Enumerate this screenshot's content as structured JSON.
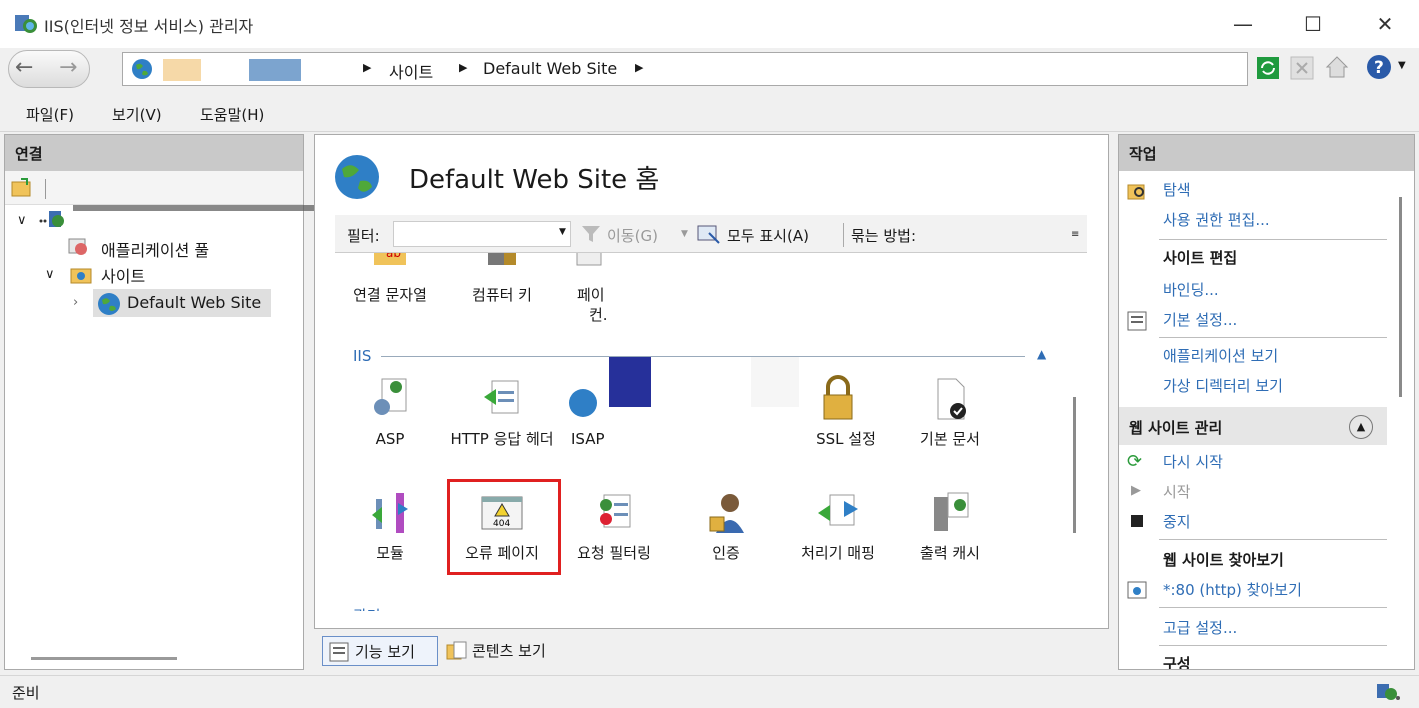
{
  "window": {
    "title": "IIS(인터넷 정보 서비스) 관리자",
    "minimize_icon": "minimize-icon",
    "maximize_icon": "maximize-icon",
    "close_icon": "close-icon"
  },
  "address": {
    "crumbs": [
      "사이트",
      "Default Web Site"
    ]
  },
  "menu": {
    "file": "파일(F)",
    "view": "보기(V)",
    "help": "도움말(H)"
  },
  "connections": {
    "title": "연결",
    "tree": {
      "app_pools": "애플리케이션 풀",
      "sites": "사이트",
      "site": "Default Web Site"
    }
  },
  "center": {
    "title": "Default Web Site 홈",
    "filter_label": "필터:",
    "go_label": "이동(G)",
    "show_all_label": "모두 표시(A)",
    "group_by_label": "묶는 방법:",
    "top_row": [
      "연결 문자열",
      "컴퓨터 키",
      "페이",
      "컨."
    ],
    "group_iis": "IIS",
    "iis_row1": [
      "ASP",
      "HTTP 응답 헤더",
      "ISAP",
      "SSL 설정",
      "기본 문서"
    ],
    "iis_row2": [
      "모듈",
      "오류 페이지",
      "요청 필터링",
      "인증",
      "처리기 매핑",
      "출력 캐시"
    ],
    "group_next": "관리",
    "bottom_tabs": {
      "features": "기능 보기",
      "content": "콘텐츠 보기"
    }
  },
  "actions": {
    "title": "작업",
    "explore": "탐색",
    "edit_perms": "사용 권한 편집...",
    "edit_site_head": "사이트 편집",
    "bindings": "바인딩...",
    "basic_settings": "기본 설정...",
    "view_apps": "애플리케이션 보기",
    "view_vdirs": "가상 디렉터리 보기",
    "manage_head": "웹 사이트 관리",
    "restart": "다시 시작",
    "start": "시작",
    "stop": "중지",
    "browse_head": "웹 사이트 찾아보기",
    "browse80": "*:80 (http) 찾아보기",
    "advanced": "고급 설정...",
    "config_head": "구성"
  },
  "status": {
    "text": "준비"
  },
  "colors": {
    "highlight_border": "#e02020",
    "link": "#2f6db5",
    "redact_blue": "#26309a"
  }
}
